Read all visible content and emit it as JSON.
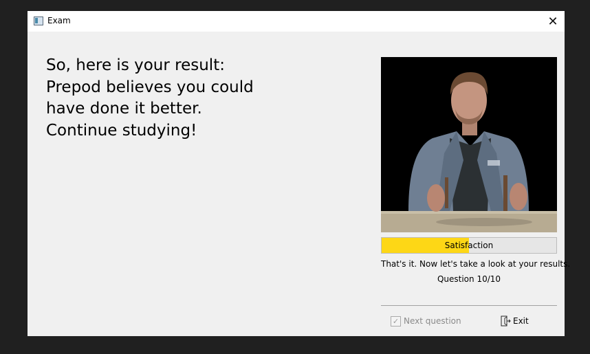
{
  "window": {
    "title": "Exam",
    "close_glyph": "✕"
  },
  "main": {
    "result_lines": [
      "So, here is your result:",
      "Prepod believes you could",
      "have done it better.",
      "Continue studying!"
    ]
  },
  "sidebar": {
    "satisfaction": {
      "label": "Satisfaction",
      "level_percent": 50,
      "fill_color": "#fdd716"
    },
    "status_text": "That's it. Now let's take a look at your results.",
    "question_counter": "Question 10/10",
    "next_button_label": "Next question",
    "exit_button_label": "Exit"
  },
  "icons": {
    "app": "window-app-icon",
    "close": "close-icon",
    "next": "checkmark-icon",
    "exit": "exit-door-icon"
  }
}
